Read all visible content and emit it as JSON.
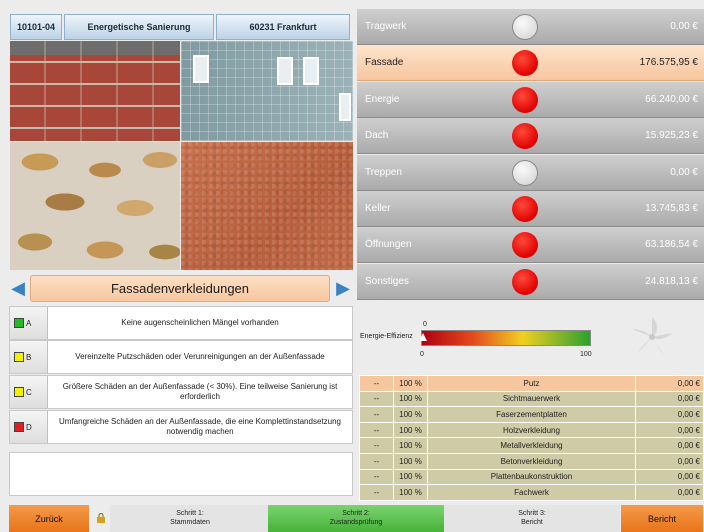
{
  "header": {
    "project_id": "10101-04",
    "project_title": "Energetische Sanierung",
    "city": "60231 Frankfurt"
  },
  "category_nav": {
    "title": "Fassadenverkleidungen",
    "prev_icon": "arrow-left-icon",
    "next_icon": "arrow-right-icon"
  },
  "conditions": [
    {
      "letter": "A",
      "color": "#22bb22",
      "text": "Keine augenscheinlichen Mängel vorhanden"
    },
    {
      "letter": "B",
      "color": "#f2f200",
      "text": "Vereinzelte Putzschäden oder Verunreinigungen an der Außenfassade"
    },
    {
      "letter": "C",
      "color": "#f2f200",
      "text": "Größere Schäden an der Außenfassade (< 30%). Eine teilweise Sanierung ist erforderlich"
    },
    {
      "letter": "D",
      "color": "#e02020",
      "text": "Umfangreiche Schäden an der Außenfassade, die eine Komplettinstandsetzung notwendig machen"
    }
  ],
  "categories": [
    {
      "name": "Tragwerk",
      "status": "grey",
      "value": "0,00 €"
    },
    {
      "name": "Fassade",
      "status": "red",
      "value": "176.575,95 €",
      "active": true
    },
    {
      "name": "Energie",
      "status": "red",
      "value": "66.240,00 €"
    },
    {
      "name": "Dach",
      "status": "red",
      "value": "15.925,23 €"
    },
    {
      "name": "Treppen",
      "status": "grey",
      "value": "0,00 €"
    },
    {
      "name": "Keller",
      "status": "red",
      "value": "13.745,83 €"
    },
    {
      "name": "Öffnungen",
      "status": "red",
      "value": "63.186,54 €"
    },
    {
      "name": "Sonstiges",
      "status": "red",
      "value": "24.818,13 €"
    }
  ],
  "energy": {
    "label": "Energie-Effizienz",
    "marker_value": "0",
    "min": "0",
    "max": "100",
    "level": 0
  },
  "materials": [
    {
      "dash": "--",
      "percent": "100 %",
      "name": "Putz",
      "value": "0,00 €",
      "highlight": true
    },
    {
      "dash": "--",
      "percent": "100 %",
      "name": "Sichtmauerwerk",
      "value": "0,00 €"
    },
    {
      "dash": "--",
      "percent": "100 %",
      "name": "Faserzementplatten",
      "value": "0,00 €"
    },
    {
      "dash": "--",
      "percent": "100 %",
      "name": "Holzverkleidung",
      "value": "0,00 €"
    },
    {
      "dash": "--",
      "percent": "100 %",
      "name": "Metallverkleidung",
      "value": "0,00 €"
    },
    {
      "dash": "--",
      "percent": "100 %",
      "name": "Betonverkleidung",
      "value": "0,00 €"
    },
    {
      "dash": "--",
      "percent": "100 %",
      "name": "Plattenbaukonstruktion",
      "value": "0,00 €"
    },
    {
      "dash": "--",
      "percent": "100 %",
      "name": "Fachwerk",
      "value": "0,00 €"
    }
  ],
  "footer": {
    "back_label": "Zurück",
    "step1": {
      "title": "Schritt 1:",
      "subtitle": "Stammdaten"
    },
    "step2": {
      "title": "Schritt 2:",
      "subtitle": "Zustandsprüfung"
    },
    "step3": {
      "title": "Schritt 3:",
      "subtitle": "Bericht"
    },
    "report_label": "Bericht"
  }
}
